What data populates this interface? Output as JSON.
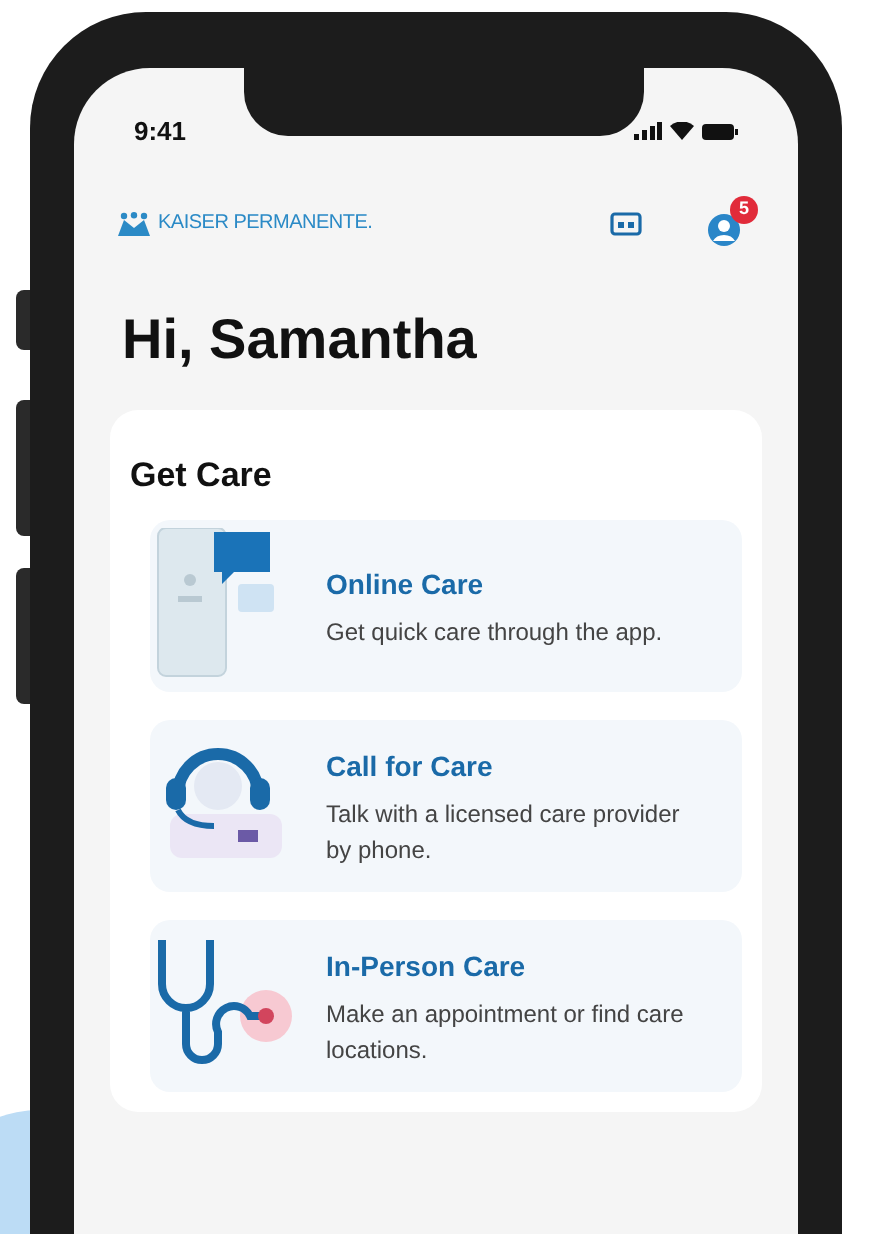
{
  "status_bar": {
    "time": "9:41"
  },
  "header": {
    "logo": "KAISER PERMANENTE.",
    "notification_count": "5"
  },
  "greeting": "Hi, Samantha",
  "get_care": {
    "title": "Get Care",
    "items": [
      {
        "kind": "online",
        "title": "Online Care",
        "description": "Get quick care through the app."
      },
      {
        "kind": "call",
        "title": "Call for Care",
        "description": "Talk with a licensed care provider by phone."
      },
      {
        "kind": "in_person",
        "title": "In-Person Care",
        "description": "Make an appointment or find care locations."
      }
    ]
  }
}
